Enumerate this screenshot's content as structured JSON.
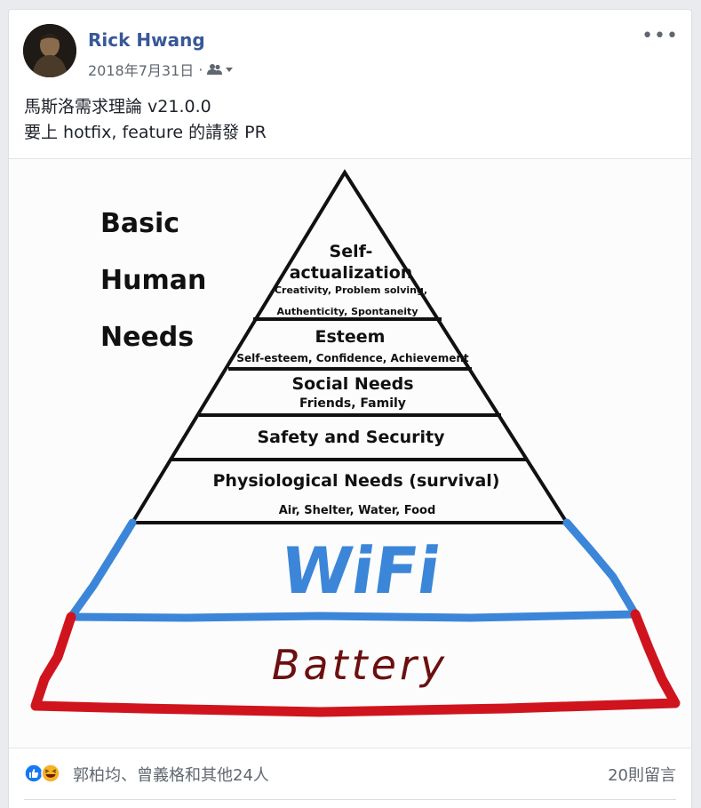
{
  "post": {
    "author": "Rick Hwang",
    "date": "2018年7月31日",
    "separator": "·",
    "audience_icon": "friends-icon",
    "more_label": "•••",
    "text_line1": "馬斯洛需求理論 v21.0.0",
    "text_line2": "要上 hotfix, feature 的請發 PR"
  },
  "image": {
    "left_title": [
      "Basic",
      "Human",
      "Needs"
    ],
    "levels": {
      "self_title_1": "Self-",
      "self_title_2": "actualization",
      "self_sub_1": "Creativity, Problem solving,",
      "self_sub_2": "Authenticity, Spontaneity",
      "esteem_title": "Esteem",
      "esteem_sub": "Self-esteem, Confidence, Achievement",
      "social_title": "Social Needs",
      "social_sub": "Friends, Family",
      "safety_title": "Safety and Security",
      "phys_title": "Physiological Needs (survival)",
      "phys_sub": "Air, Shelter, Water, Food"
    },
    "wifi_label": "WiFi",
    "battery_label": "Battery",
    "colors": {
      "wifi": "#3b86d8",
      "battery": "#d0141e",
      "ink": "#111111",
      "battery_text": "#6b1010"
    }
  },
  "footer": {
    "reactions": [
      "like-icon",
      "haha-icon"
    ],
    "likes_text": "郭柏均、曾義格和其他24人",
    "comments_text": "20則留言"
  },
  "colors": {
    "link": "#385898",
    "secondary": "#606770",
    "like": "#1877f2",
    "haha": "#f7b125"
  }
}
